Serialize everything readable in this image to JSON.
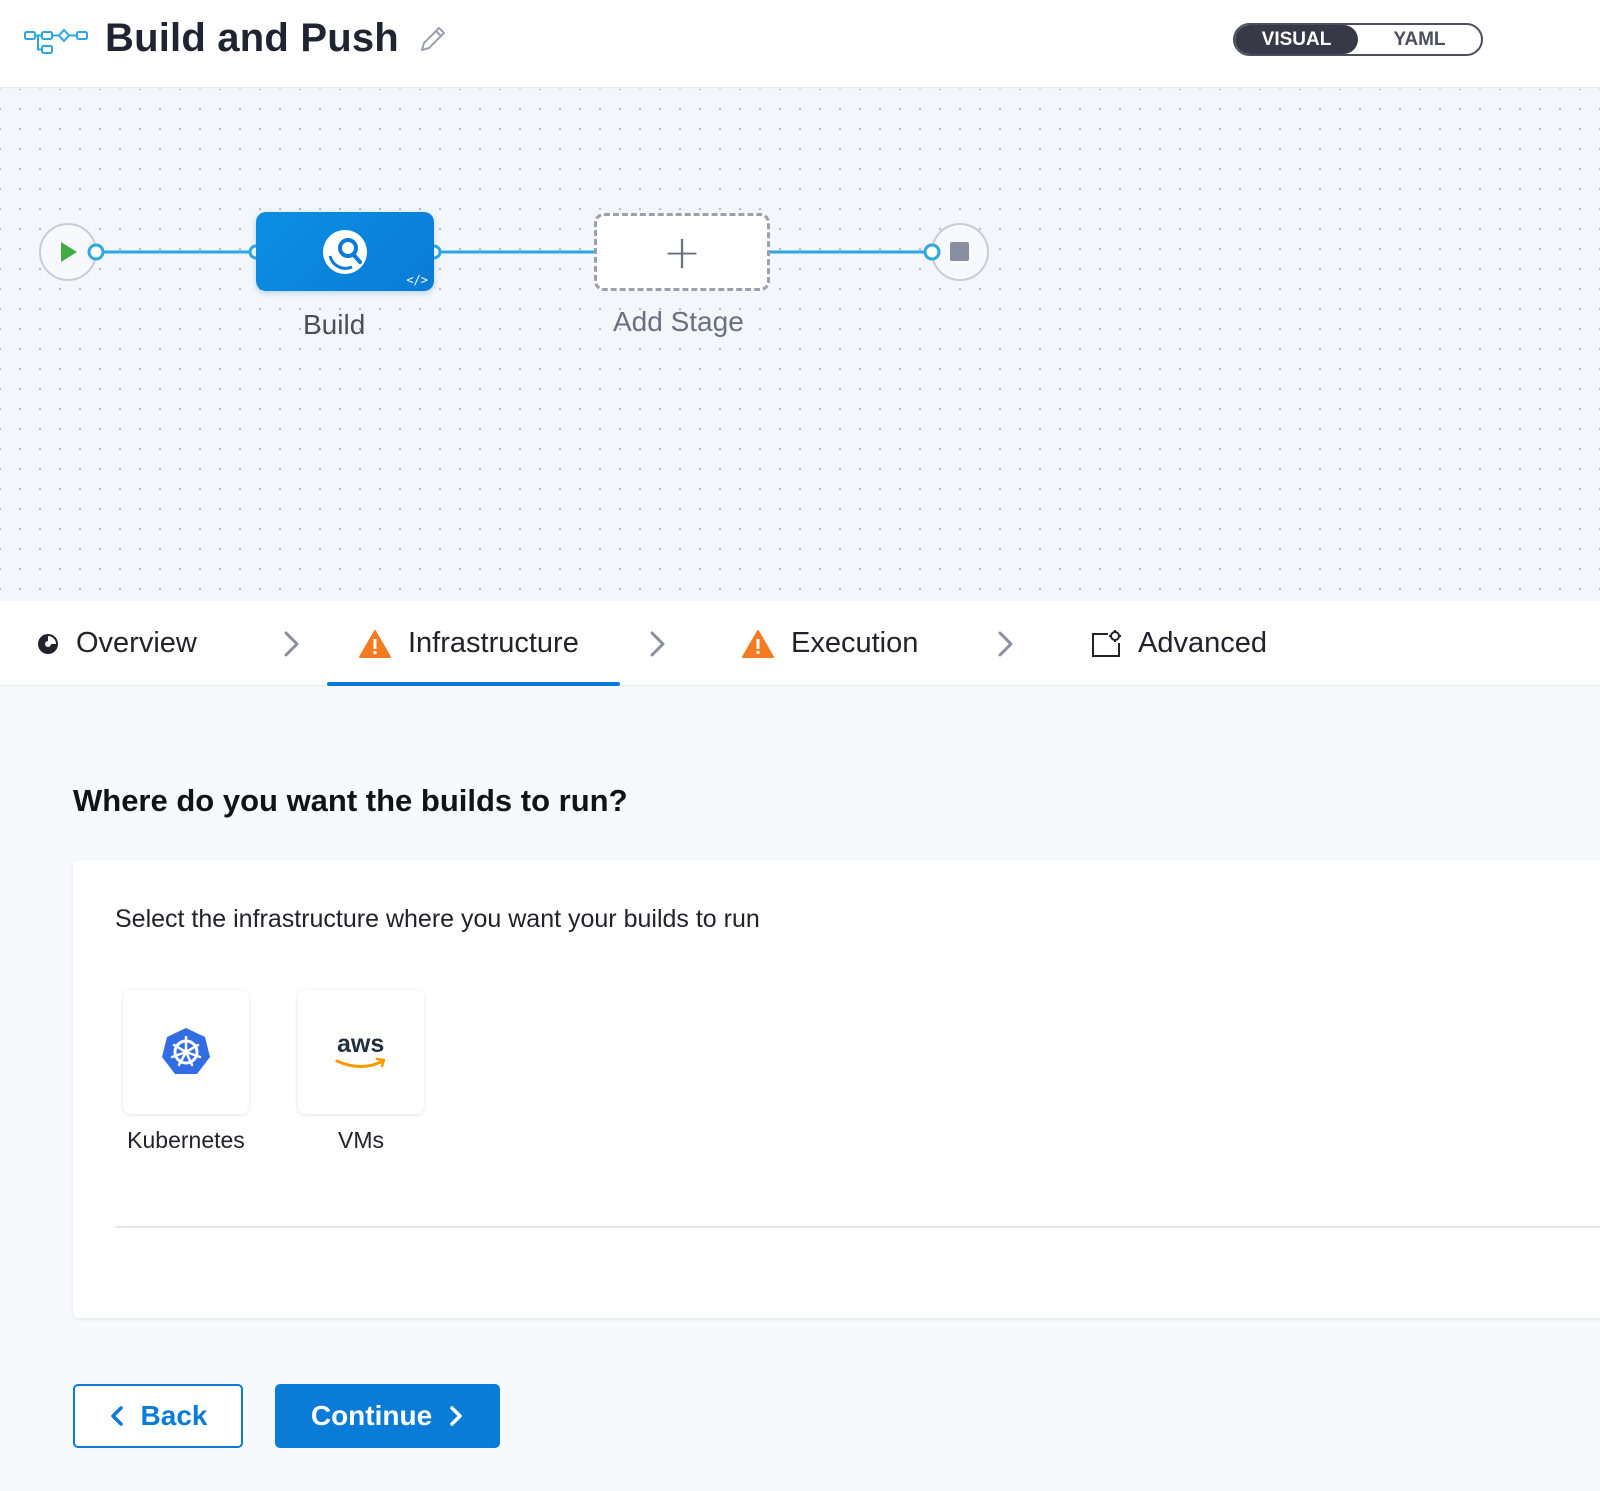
{
  "header": {
    "title": "Build and Push",
    "view_toggle": {
      "visual_label": "VISUAL",
      "yaml_label": "YAML",
      "active": "VISUAL"
    }
  },
  "pipeline": {
    "stages": [
      {
        "label": "Build"
      }
    ],
    "add_stage_label": "Add Stage"
  },
  "tabs": [
    {
      "label": "Overview",
      "icon": "pie-chart-icon"
    },
    {
      "label": "Infrastructure",
      "icon": "warning-icon",
      "active": true
    },
    {
      "label": "Execution",
      "icon": "warning-icon"
    },
    {
      "label": "Advanced",
      "icon": "advanced-settings-icon"
    }
  ],
  "main": {
    "question": "Where do you want the builds to run?",
    "description": "Select the infrastructure where you want your builds to run",
    "options": [
      {
        "label": "Kubernetes",
        "icon": "kubernetes-icon"
      },
      {
        "label": "VMs",
        "icon": "aws-icon",
        "icon_text": "aws"
      }
    ]
  },
  "buttons": {
    "back_label": "Back",
    "continue_label": "Continue"
  },
  "colors": {
    "primary": "#0a7bd6",
    "warning": "#f47b20",
    "connector": "#2ea7e0",
    "start_green": "#42ab45",
    "toggle_dark": "#383946",
    "kubernetes_blue": "#326ce5",
    "aws_orange": "#ff9900"
  }
}
